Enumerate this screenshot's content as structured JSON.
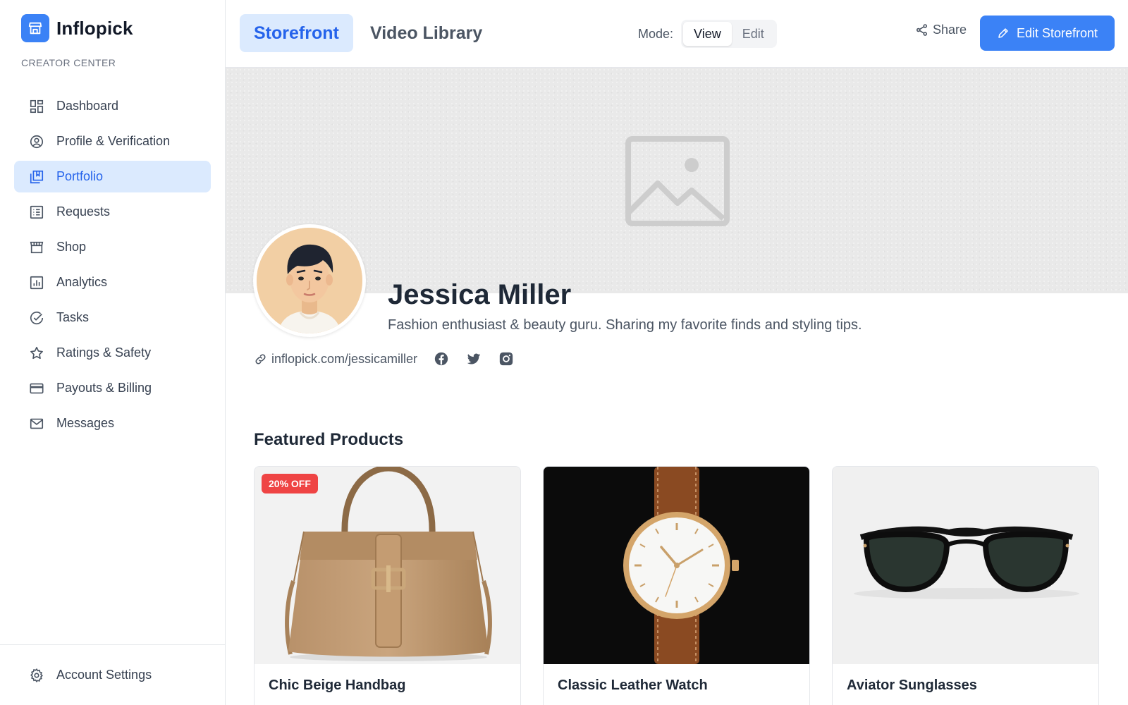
{
  "app": {
    "name": "Inflopick",
    "section_label": "CREATOR CENTER"
  },
  "sidebar": {
    "items": [
      {
        "label": "Dashboard",
        "icon": "dashboard-icon"
      },
      {
        "label": "Profile & Verification",
        "icon": "user-circle-icon"
      },
      {
        "label": "Portfolio",
        "icon": "portfolio-icon",
        "active": true
      },
      {
        "label": "Requests",
        "icon": "list-icon"
      },
      {
        "label": "Shop",
        "icon": "store-icon"
      },
      {
        "label": "Analytics",
        "icon": "bar-chart-icon"
      },
      {
        "label": "Tasks",
        "icon": "check-circle-icon"
      },
      {
        "label": "Ratings & Safety",
        "icon": "star-icon"
      },
      {
        "label": "Payouts & Billing",
        "icon": "credit-card-icon"
      },
      {
        "label": "Messages",
        "icon": "mail-icon"
      }
    ],
    "footer": {
      "label": "Account Settings",
      "icon": "gear-icon"
    }
  },
  "topbar": {
    "tabs": [
      {
        "label": "Storefront",
        "active": true
      },
      {
        "label": "Video Library",
        "active": false
      }
    ],
    "mode": {
      "label": "Mode:",
      "options": [
        "View",
        "Edit"
      ],
      "selected": "View"
    },
    "share_label": "Share",
    "edit_label": "Edit Storefront"
  },
  "profile": {
    "name": "Jessica Miller",
    "bio": "Fashion enthusiast & beauty guru. Sharing my favorite finds and styling tips.",
    "url": "inflopick.com/jessicamiller",
    "socials": [
      "facebook-icon",
      "twitter-icon",
      "instagram-icon"
    ]
  },
  "featured": {
    "title": "Featured Products",
    "products": [
      {
        "title": "Chic Beige Handbag",
        "badge": "20% OFF"
      },
      {
        "title": "Classic Leather Watch"
      },
      {
        "title": "Aviator Sunglasses"
      }
    ]
  },
  "colors": {
    "accent": "#3b82f6",
    "accent_soft": "#dbeafe",
    "badge": "#ef4444"
  }
}
